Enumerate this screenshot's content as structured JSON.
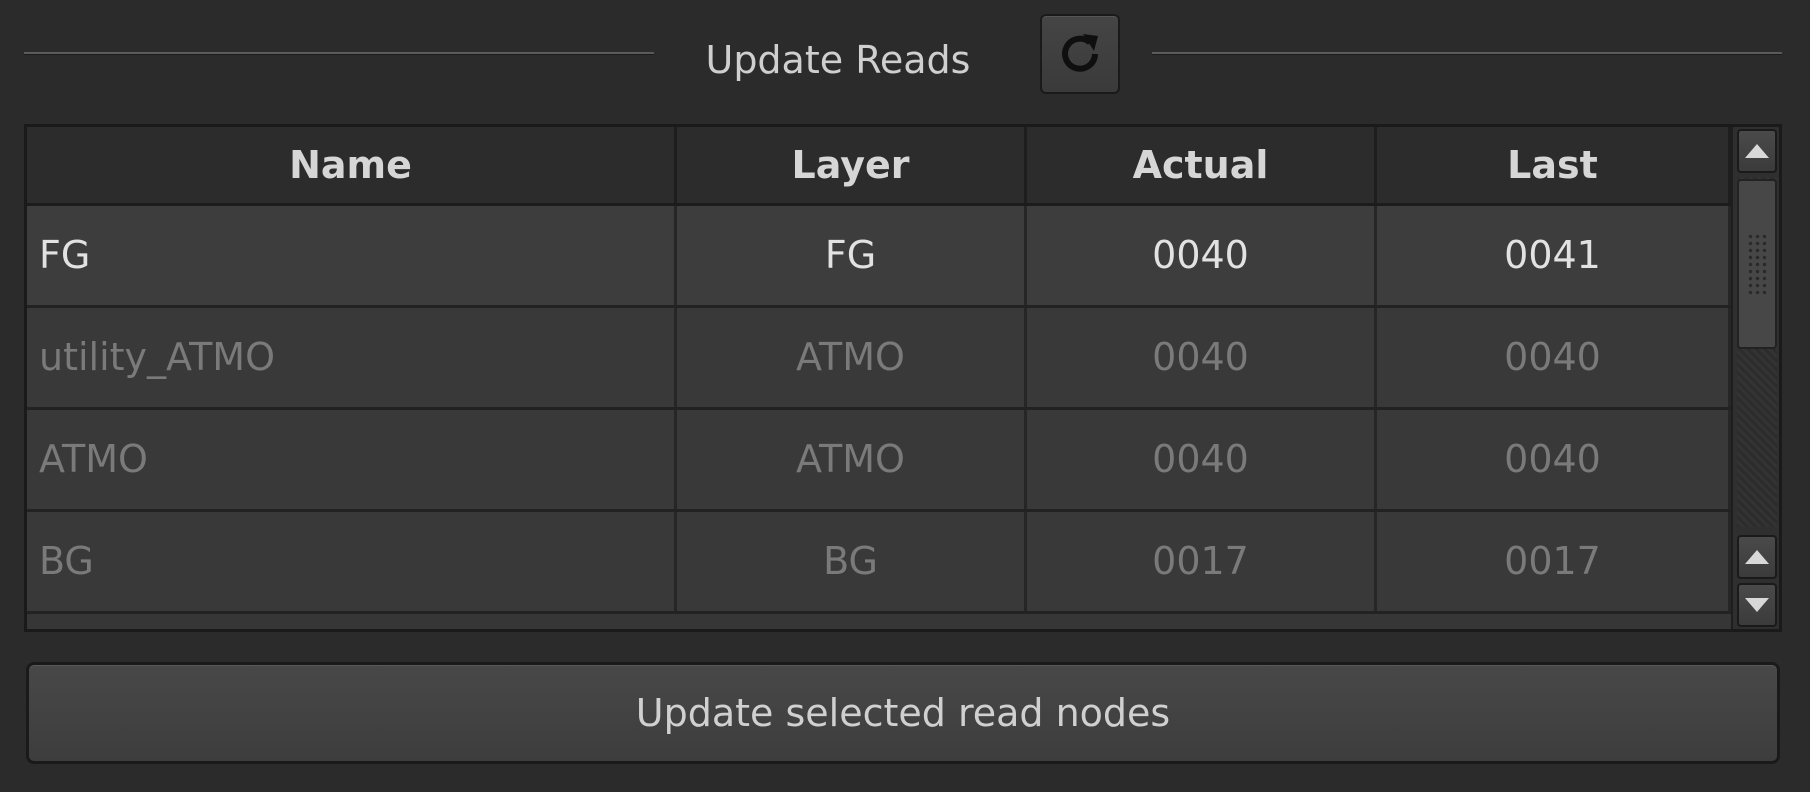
{
  "panel": {
    "title": "Update Reads"
  },
  "refresh_button": {
    "icon": "refresh-icon"
  },
  "table": {
    "columns": [
      "Name",
      "Layer",
      "Actual",
      "Last"
    ],
    "rows": [
      {
        "name": "FG",
        "layer": "FG",
        "actual": "0040",
        "last": "0041",
        "state": "active"
      },
      {
        "name": "utility_ATMO",
        "layer": "ATMO",
        "actual": "0040",
        "last": "0040",
        "state": "inactive"
      },
      {
        "name": "ATMO",
        "layer": "ATMO",
        "actual": "0040",
        "last": "0040",
        "state": "inactive"
      },
      {
        "name": "BG",
        "layer": "BG",
        "actual": "0017",
        "last": "0017",
        "state": "inactive"
      }
    ]
  },
  "scrollbar": {
    "icons": [
      "arrow-up-icon",
      "arrow-up-icon",
      "arrow-down-icon"
    ]
  },
  "action": {
    "label": "Update selected read nodes"
  },
  "colors": {
    "background": "#2b2b2b",
    "active_text": "#e2e2e2",
    "inactive_text": "#7a7a7a"
  }
}
